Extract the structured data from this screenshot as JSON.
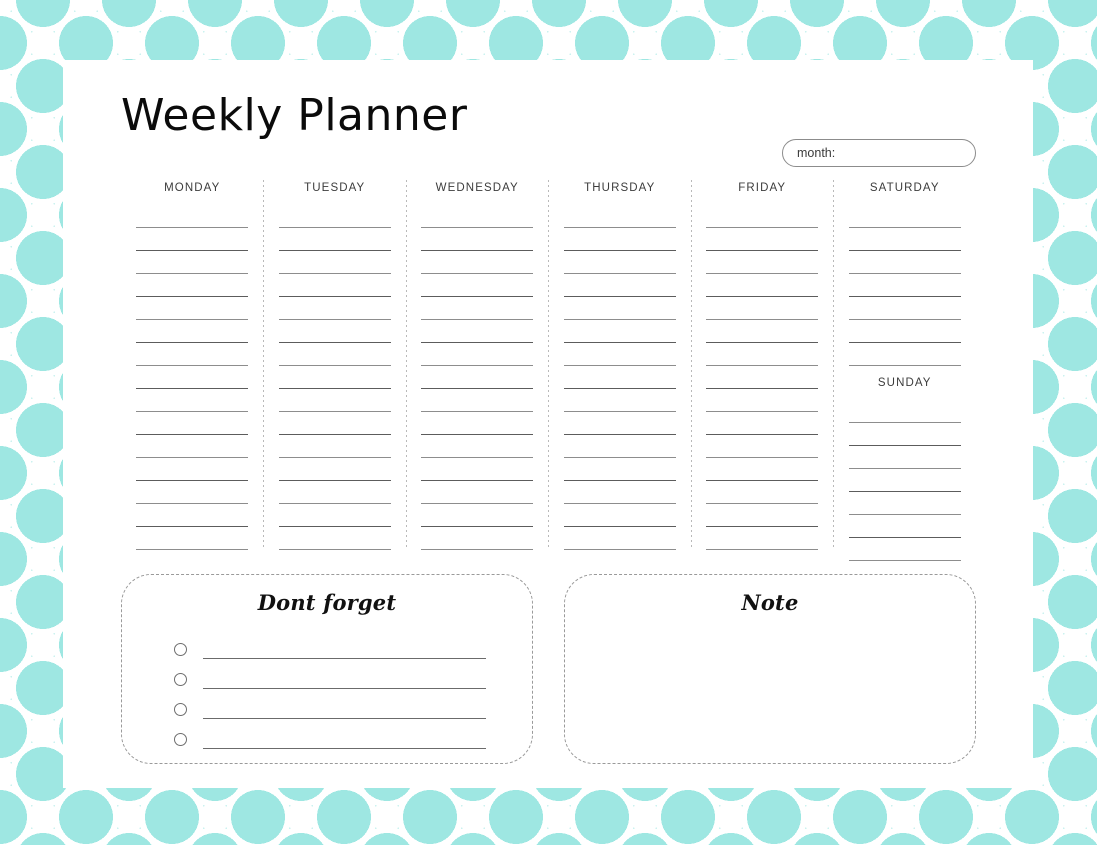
{
  "theme": {
    "accent": "#9ee7e2",
    "sheet_bg": "#ffffff",
    "line_color": "#5c5c5c",
    "dash_color": "#9a9a9a",
    "text_color": "#0b0b0b"
  },
  "header": {
    "title": "Weekly Planner",
    "month_label": "month:",
    "month_value": ""
  },
  "week": {
    "columns": [
      {
        "name": "MONDAY",
        "line_count": 15,
        "second_name": null,
        "second_line_count": 0
      },
      {
        "name": "TUESDAY",
        "line_count": 15,
        "second_name": null,
        "second_line_count": 0
      },
      {
        "name": "WEDNESDAY",
        "line_count": 15,
        "second_name": null,
        "second_line_count": 0
      },
      {
        "name": "THURSDAY",
        "line_count": 15,
        "second_name": null,
        "second_line_count": 0
      },
      {
        "name": "FRIDAY",
        "line_count": 15,
        "second_name": null,
        "second_line_count": 0
      },
      {
        "name": "SATURDAY",
        "line_count": 7,
        "second_name": "SUNDAY",
        "second_line_count": 7
      }
    ]
  },
  "dont_forget": {
    "title": "Dont forget",
    "items": [
      {
        "checked": false,
        "text": ""
      },
      {
        "checked": false,
        "text": ""
      },
      {
        "checked": false,
        "text": ""
      },
      {
        "checked": false,
        "text": ""
      }
    ]
  },
  "note": {
    "title": "Note",
    "text": ""
  }
}
